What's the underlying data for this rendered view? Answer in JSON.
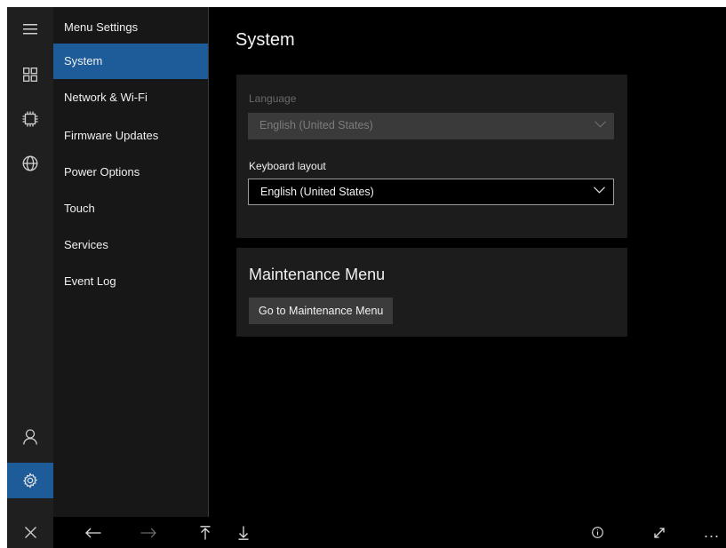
{
  "menu": {
    "header": "Menu Settings",
    "items": [
      {
        "label": "System",
        "selected": true
      },
      {
        "label": "Network & Wi-Fi"
      },
      {
        "label": "Firmware Updates"
      },
      {
        "label": "Power Options"
      },
      {
        "label": "Touch"
      },
      {
        "label": "Services"
      },
      {
        "label": "Event Log"
      }
    ]
  },
  "rail": {
    "top_icons": [
      "hamburger-icon",
      "apps-grid-icon",
      "processor-icon",
      "globe-icon"
    ],
    "bottom_icons": [
      "user-icon",
      "settings-icon"
    ],
    "active": "settings-icon"
  },
  "page": {
    "title": "System",
    "language": {
      "label": "Language",
      "value": "English (United States)",
      "disabled": true
    },
    "keyboard": {
      "label": "Keyboard layout",
      "value": "English (United States)"
    },
    "maintenance": {
      "title": "Maintenance Menu",
      "button_label": "Go to Maintenance Menu"
    }
  },
  "bottombar": {
    "icons": [
      "close-icon",
      "back-arrow-icon",
      "forward-arrow-icon",
      "scroll-top-icon",
      "scroll-bottom-icon",
      "info-icon",
      "fullscreen-icon",
      "more-icon"
    ],
    "more_label": "..."
  },
  "colors": {
    "accent": "#1e5c99",
    "background": "#000000",
    "rail": "#1f1f1f",
    "menu": "#171717",
    "card": "#1c1c1c"
  }
}
